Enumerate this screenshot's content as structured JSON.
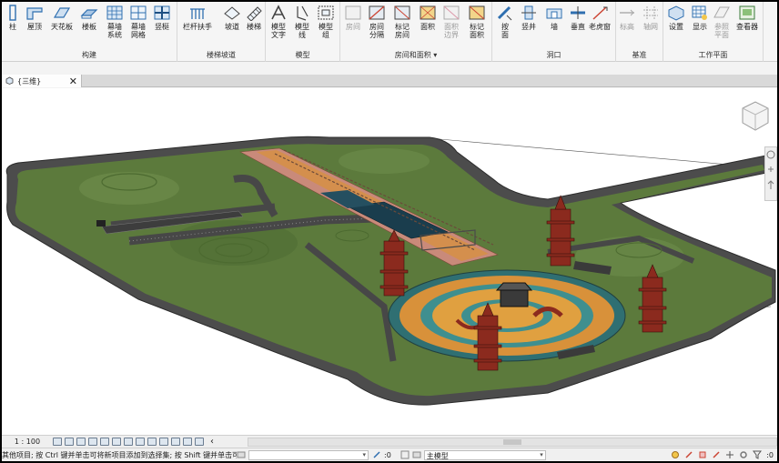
{
  "ribbon": {
    "panels": {
      "build": "构建",
      "stairs": "楼梯坡道",
      "model": "模型",
      "rooms": "房间和面积 ▾",
      "opening": "洞口",
      "datum": "基准",
      "workplane": "工作平面"
    },
    "tools": {
      "column": "柱",
      "roof": "屋顶",
      "ceiling": "天花板",
      "floor": "楼板",
      "curtain_system_1": "幕墙",
      "curtain_system_2": "系统",
      "curtain_grid_1": "幕墙",
      "curtain_grid_2": "网格",
      "mullion": "竖梃",
      "railing": "栏杆扶手",
      "ramp": "坡道",
      "stair": "楼梯",
      "model_text_1": "模型",
      "model_text_2": "文字",
      "model_line_1": "模型",
      "model_line_2": "线",
      "model_group_1": "模型",
      "model_group_2": "组",
      "room": "房间",
      "room_sep_1": "房间",
      "room_sep_2": "分隔",
      "tag_room_1": "标记",
      "tag_room_2": "房间",
      "area": "面积",
      "area_boundary_1": "面积",
      "area_boundary_2": "边界",
      "tag_area_1": "标记",
      "tag_area_2": "面积",
      "by_face_1": "按",
      "by_face_2": "面",
      "shaft": "竖井",
      "wall_opening": "墙",
      "vertical": "垂直",
      "dormer": "老虎窗",
      "level": "标高",
      "grid": "轴网",
      "set": "设置",
      "show": "显示",
      "ref_plane_1": "参照",
      "ref_plane_2": "平面",
      "viewer": "查看器"
    }
  },
  "tab": {
    "label": "{三维}",
    "close": "✕"
  },
  "viewbar": {
    "scale": "1 : 100",
    "arrow": "‹"
  },
  "status": {
    "message": "其他项目; 按 Ctrl 键并单击可将新项目添加到选择集; 按 Shift 键并单击可",
    "count_left": ":0",
    "model": "主模型",
    "filter_count": ":0"
  },
  "colors": {
    "ribbon_icon": "#2f6fb0",
    "grass": "#5c7a3c",
    "road": "#4a4a4a",
    "plaza_orange": "#d8913a",
    "plaza_teal": "#3f8f8f",
    "water": "#1a3d4d",
    "pink_path": "#c98a7a",
    "tower": "#8b2a1e"
  }
}
